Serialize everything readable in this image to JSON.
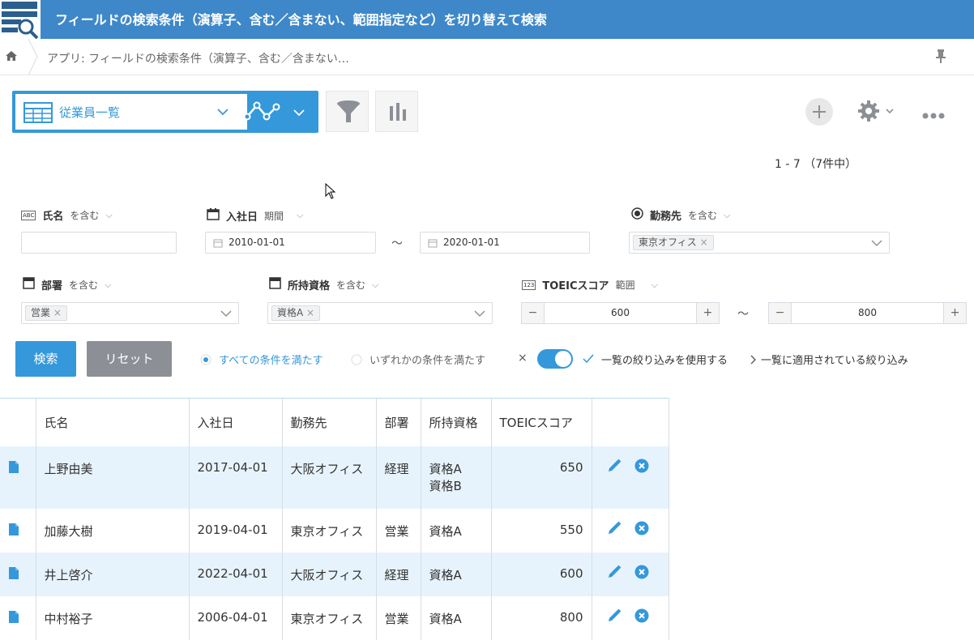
{
  "app": {
    "title": "フィールドの検索条件（演算子、含む／含まない、範囲指定など）を切り替えて検索",
    "breadcrumb": "アプリ: フィールドの検索条件（演算子、含む／含まない…"
  },
  "view": {
    "name": "従業員一覧",
    "record_range": "1 - 7 （7件中）"
  },
  "filters": {
    "name_label": "氏名",
    "name_cond": "を含む",
    "name_value": "",
    "hire_label": "入社日",
    "hire_cond": "期間",
    "hire_from": "2010-01-01",
    "hire_to": "2020-01-01",
    "range_sep": "〜",
    "office_label": "勤務先",
    "office_cond": "を含む",
    "office_chip": "東京オフィス",
    "dept_label": "部署",
    "dept_cond": "を含む",
    "dept_chip": "営業",
    "qual_label": "所持資格",
    "qual_cond": "を含む",
    "qual_chip": "資格A",
    "toeic_label": "TOEICスコア",
    "toeic_cond": "範囲",
    "toeic_from": "600",
    "toeic_to": "800",
    "abc_badge": "ABC",
    "num_badge": "123"
  },
  "actions": {
    "search": "検索",
    "reset": "リセット",
    "match_all": "すべての条件を満たす",
    "match_any": "いずれかの条件を満たす",
    "use_list_filter": "一覧の絞り込みを使用する",
    "applied_filter": "一覧に適用されている絞り込み"
  },
  "table": {
    "headers": [
      "氏名",
      "入社日",
      "勤務先",
      "部署",
      "所持資格",
      "TOEICスコア"
    ],
    "rows": [
      {
        "name": "上野由美",
        "date": "2017-04-01",
        "office": "大阪オフィス",
        "dept": "経理",
        "qual": "資格A",
        "qual2": "資格B",
        "score": "650"
      },
      {
        "name": "加藤大樹",
        "date": "2019-04-01",
        "office": "東京オフィス",
        "dept": "営業",
        "qual": "資格A",
        "score": "550"
      },
      {
        "name": "井上啓介",
        "date": "2022-04-01",
        "office": "大阪オフィス",
        "dept": "経理",
        "qual": "資格A",
        "score": "600"
      },
      {
        "name": "中村裕子",
        "date": "2006-04-01",
        "office": "東京オフィス",
        "dept": "営業",
        "qual": "資格A",
        "score": "800"
      }
    ]
  },
  "icons": {
    "accent": "#3498db",
    "header_bg": "#3e88c9",
    "list": "list-icon",
    "graph": "graph-icon",
    "funnel": "funnel-icon",
    "chart": "bar-chart-icon",
    "add": "plus-icon",
    "gear": "gear-icon",
    "more": "more-icon",
    "pin": "pin-icon",
    "edit": "pencil-icon",
    "delete": "close-circle-icon",
    "record": "document-icon"
  }
}
